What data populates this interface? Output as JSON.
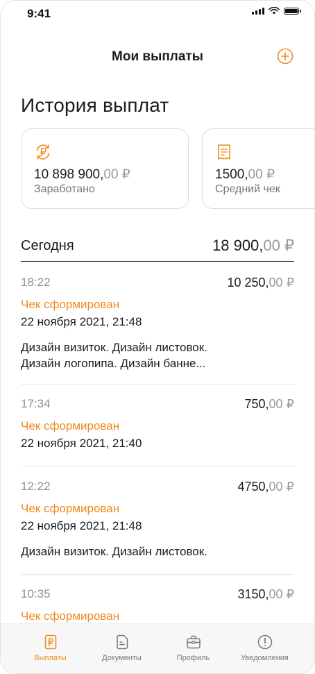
{
  "status_bar": {
    "time": "9:41"
  },
  "header": {
    "title": "Мои выплаты"
  },
  "section": {
    "title": "История выплат"
  },
  "summary_cards": [
    {
      "icon": "ruble-refresh-icon",
      "amount_int": "10 898 900,",
      "amount_dec": "00 ₽",
      "label": "Заработано"
    },
    {
      "icon": "receipt-icon",
      "amount_int": "1500,",
      "amount_dec": "00 ₽",
      "label": "Средний чек"
    }
  ],
  "day_group": {
    "title": "Сегодня",
    "total_int": "18 900,",
    "total_dec": "00 ₽"
  },
  "payments": [
    {
      "time": "18:22",
      "amount_int": "10 250,",
      "amount_dec": "00 ₽",
      "status": "Чек сформирован",
      "date": "22 ноября 2021, 21:48",
      "description_line1": "Дизайн визиток. Дизайн листовок.",
      "description_line2": "Дизайн логопипа. Дизайн банне..."
    },
    {
      "time": "17:34",
      "amount_int": "750,",
      "amount_dec": "00 ₽",
      "status": "Чек сформирован",
      "date": "22 ноября 2021, 21:40",
      "description_line1": "",
      "description_line2": ""
    },
    {
      "time": "12:22",
      "amount_int": "4750,",
      "amount_dec": "00 ₽",
      "status": "Чек сформирован",
      "date": "22 ноября 2021, 21:48",
      "description_line1": "Дизайн визиток. Дизайн листовок.",
      "description_line2": ""
    },
    {
      "time": "10:35",
      "amount_int": "3150,",
      "amount_dec": "00 ₽",
      "status": "Чек сформирован",
      "date": "",
      "description_line1": "",
      "description_line2": ""
    }
  ],
  "tabs": [
    {
      "label": "Выплаты",
      "icon": "ruble-doc-icon",
      "active": true
    },
    {
      "label": "Документы",
      "icon": "document-icon",
      "active": false
    },
    {
      "label": "Профиль",
      "icon": "briefcase-icon",
      "active": false
    },
    {
      "label": "Уведомления",
      "icon": "alert-icon",
      "active": false
    }
  ],
  "colors": {
    "accent": "#f08a1c",
    "text": "#1b1b1b",
    "muted": "#8f8f8f"
  }
}
